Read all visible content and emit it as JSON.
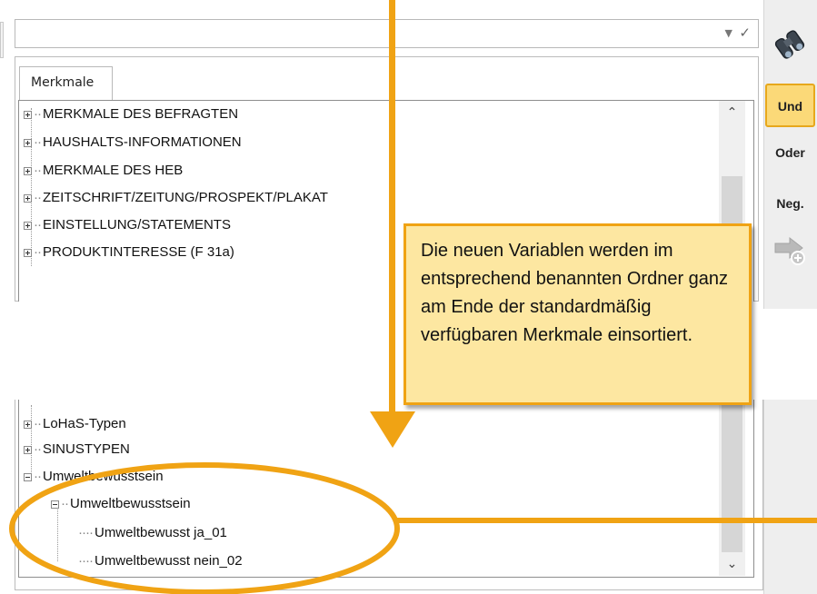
{
  "tab_label": "Merkmale",
  "top_tree": [
    {
      "label": "MERKMALE DES BEFRAGTEN",
      "expander": "plus"
    },
    {
      "label": "HAUSHALTS-INFORMATIONEN",
      "expander": "plus"
    },
    {
      "label": "MERKMALE DES HEB",
      "expander": "plus"
    },
    {
      "label": "ZEITSCHRIFT/ZEITUNG/PROSPEKT/PLAKAT",
      "expander": "plus"
    },
    {
      "label": "EINSTELLUNG/STATEMENTS",
      "expander": "plus"
    },
    {
      "label": "PRODUKTINTERESSE (F 31a)",
      "expander": "plus"
    }
  ],
  "bottom_tree": [
    {
      "label": "LoHaS-Typen",
      "expander": "plus"
    },
    {
      "label": "SINUSTYPEN",
      "expander": "plus"
    },
    {
      "label": "Umweltbewusstsein",
      "expander": "minus"
    },
    {
      "label": "Umweltbewusstsein",
      "expander": "minus"
    },
    {
      "label": "Umweltbewusst ja_01",
      "expander": "none"
    },
    {
      "label": "Umweltbewusst nein_02",
      "expander": "none"
    }
  ],
  "toolbar": {
    "search_icon": "binoculars-icon",
    "und": "Und",
    "oder": "Oder",
    "neg": "Neg.",
    "add_icon": "arrow-add-icon"
  },
  "callout_text": "Die neuen Variablen werden im entsprechend benannten Ordner ganz am Ende der standardmäßig verfügbaren Merkmale einsortiert.",
  "colors": {
    "accent": "#f0a314",
    "callout_fill": "#fde7a1",
    "und_fill": "#fbd978"
  }
}
